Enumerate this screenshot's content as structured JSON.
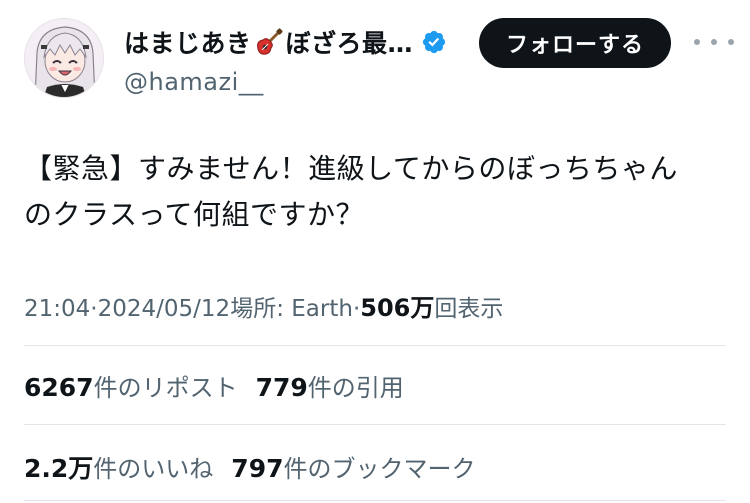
{
  "user": {
    "display_name": "はまじあき",
    "display_name_suffix": "ぼざろ最…",
    "handle": "@hamazi__",
    "verified": true
  },
  "actions": {
    "follow_label": "フォローする",
    "more_icon": "more-horizontal-icon"
  },
  "tweet": {
    "text_line1": "【緊急】すみません！進級してからのぼっちちゃん",
    "text_line2": "のクラスって何組ですか？"
  },
  "meta": {
    "time": "21:04",
    "sep1": " · ",
    "date": "2024/05/12",
    "location": " 場所: Earth",
    "sep2": " · ",
    "views_num": "506万",
    "views_label": "回表示"
  },
  "stats": {
    "reposts_num": "6267",
    "reposts_label": "件のリポスト",
    "quotes_num": "779",
    "quotes_label": "件の引用",
    "likes_num": "2.2万",
    "likes_label": "件のいいね",
    "bookmarks_num": "797",
    "bookmarks_label": "件のブックマーク"
  },
  "colors": {
    "text_primary": "#0f1419",
    "text_secondary": "#536471",
    "verified": "#1d9bf0",
    "follow_bg": "#0f1419",
    "divider": "#e3e7ea"
  }
}
